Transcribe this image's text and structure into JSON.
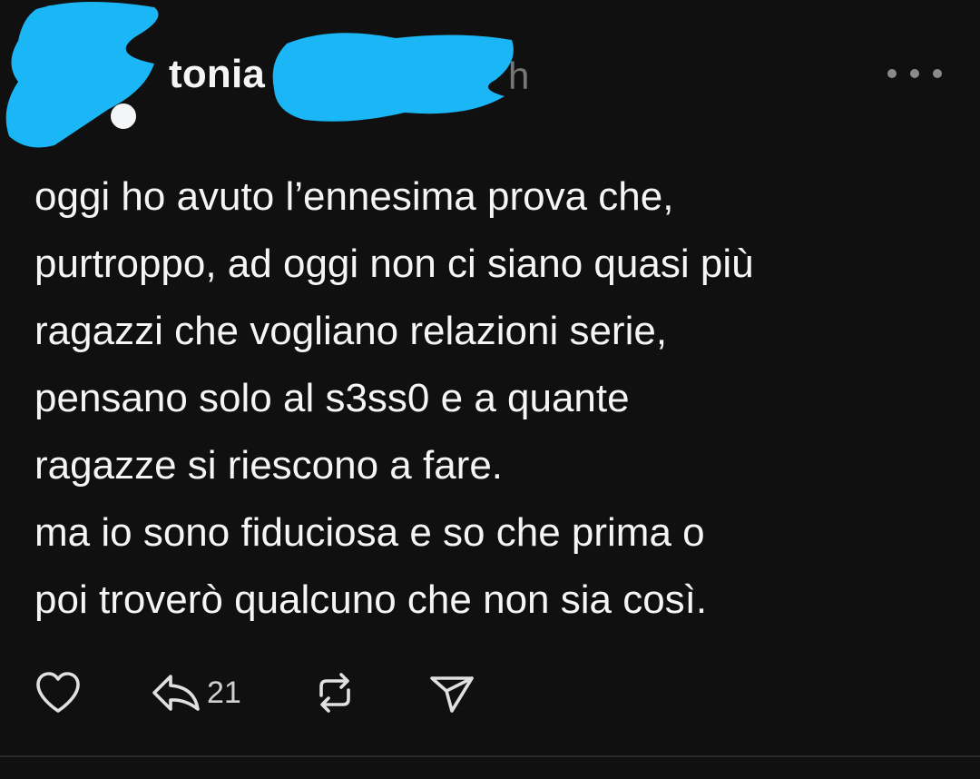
{
  "post": {
    "username": "tonia",
    "time_fragment": "h",
    "body": "oggi ho avuto l’ennesima prova che,\npurtroppo, ad oggi non ci siano quasi più\nragazzi che vogliano relazioni serie,\npensano solo al s3ss0 e a quante\nragazze si riescono a fare.\nma io sono fiduciosa e so che prima o\npoi troverò qualcuno che non sia così.",
    "reply_count": "21"
  },
  "icons": {
    "more": "more-icon",
    "like": "heart-icon",
    "reply": "reply-icon",
    "repost": "repost-icon",
    "share": "send-icon"
  },
  "colors": {
    "background": "#101010",
    "text": "#f3f5f7",
    "muted": "#777777",
    "redaction": "#1ab6f5"
  }
}
